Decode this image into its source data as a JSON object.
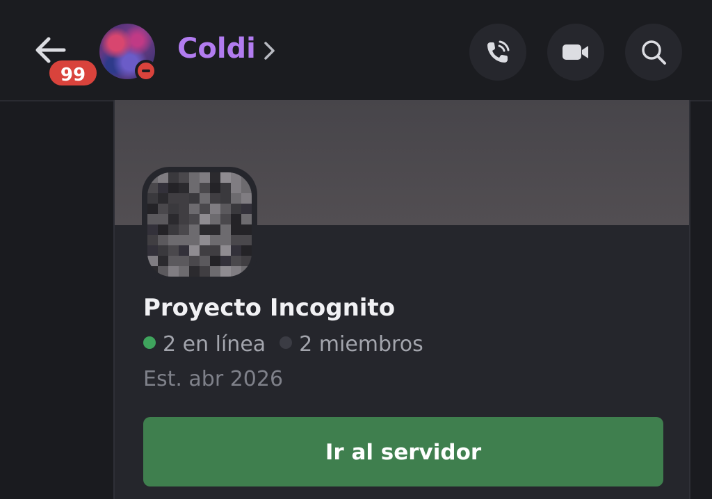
{
  "header": {
    "back_label": "Back",
    "unread_count": "99",
    "channel_name": "Coldi",
    "user_status": "do-not-disturb",
    "icons": {
      "back": "arrow-left-icon",
      "chevron": "chevron-right-icon",
      "call": "phone-call-icon",
      "video": "video-camera-icon",
      "search": "search-icon"
    }
  },
  "invite": {
    "server_name": "Proyecto Incognito",
    "online_text": "2 en línea",
    "members_text": "2 miembros",
    "established": "Est. abr 2026",
    "join_label": "Ir al servidor"
  },
  "colors": {
    "background": "#1a1b1f",
    "header_bg": "#1b1c20",
    "card_bg": "#25262c",
    "banner": "#4d4a4e",
    "accent_name": "#b27cf0",
    "badge_red": "#d9433c",
    "online_green": "#3fa45d",
    "join_green": "#3f7f4e"
  }
}
